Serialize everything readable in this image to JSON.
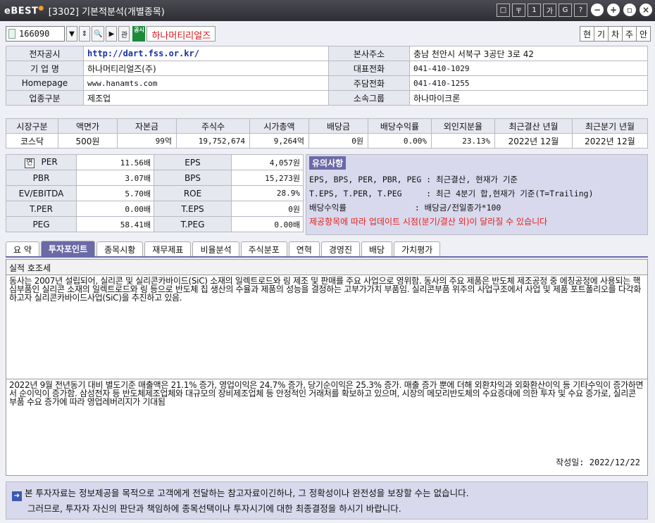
{
  "window": {
    "logo": "eBEST",
    "title": "[3302] 기본적분석(개별종목)",
    "controls": [
      "□",
      "〒",
      "1",
      "가",
      "G",
      "?"
    ]
  },
  "toolbar": {
    "stock_code": "166090",
    "company_name": "하나머티리얼즈",
    "right_buttons": [
      "현",
      "기",
      "차",
      "주",
      "안"
    ],
    "corp_badge": "공시"
  },
  "info": {
    "rows": [
      {
        "l1": "전자공시",
        "v1": "http://dart.fss.or.kr/",
        "l2": "본사주소",
        "v2": "충남 천안시 서북구 3공단 3로 42"
      },
      {
        "l1": "기 업 명",
        "v1": "하나머티리얼즈(주)",
        "l2": "대표전화",
        "v2": "041-410-1029"
      },
      {
        "l1": "Homepage",
        "v1": "www.hanamts.com",
        "l2": "주담전화",
        "v2": "041-410-1255"
      },
      {
        "l1": "업종구분",
        "v1": "제조업",
        "l2": "소속그룹",
        "v2": "하나마이크론"
      }
    ]
  },
  "market": {
    "headers": [
      "시장구분",
      "액면가",
      "자본금",
      "주식수",
      "시가총액",
      "배당금",
      "배당수익률",
      "외인지분율",
      "최근결산 년월",
      "최근분기 년월"
    ],
    "values": [
      "코스닥",
      "500원",
      "99억",
      "19,752,674",
      "9,264억",
      "0원",
      "0.00%",
      "23.13%",
      "2022년 12월",
      "2022년 12월"
    ]
  },
  "ratios": {
    "yun_label": "연",
    "rows": [
      {
        "l1": "PER",
        "v1": "11.56배",
        "l2": "EPS",
        "v2": "4,057원"
      },
      {
        "l1": "PBR",
        "v1": "3.07배",
        "l2": "BPS",
        "v2": "15,273원"
      },
      {
        "l1": "EV/EBITDA",
        "v1": "5.70배",
        "l2": "ROE",
        "v2": "28.9%"
      },
      {
        "l1": "T.PER",
        "v1": "0.00배",
        "l2": "T.EPS",
        "v2": "0원"
      },
      {
        "l1": "PEG",
        "v1": "58.41배",
        "l2": "T.PEG",
        "v2": "0.00배"
      }
    ]
  },
  "notice": {
    "title": "유의사항",
    "lines": [
      "EPS, BPS, PER, PBR, PEG : 최근결산, 현재가 기준",
      "T.EPS, T.PER, T.PEG     : 최근 4분기 합,현재가 기준(T=Trailing)",
      "배당수익률              : 배당금/전일종가*100"
    ],
    "warning": "제공항목에 따라 업데이트 시점(분기/결산 외)이 달라질 수 있습니다"
  },
  "tabs": [
    "요 약",
    "투자포인트",
    "종목시황",
    "재무제표",
    "비율분석",
    "주식분포",
    "연혁",
    "경영진",
    "배당",
    "가치평가"
  ],
  "active_tab": 1,
  "content": {
    "section_title": "실적 호조세",
    "para1": "동사는 2007년 설립되어, 실리콘 및 실리콘카바이드(SiC) 소재의 일렉트로드와 링 제조 및 판매를 주요 사업으로 영위함. 동사의 주요 제품은 반도체 제조공정 중 에칭공정에 사용되는 핵심부품인 실리콘 소재의 일렉트로드와 링 등으로 반도체 칩 생산의 수율과 제품의 성능을 결정하는 고부가가치 부품임. 실리콘부품 위주의 사업구조에서 사업 및 제품 포트폴리오를 다각화하고자 실리콘카바이드사업(SiC)을 추진하고 있음.",
    "para2": "2022년 9월 전년동기 대비 별도기준 매출액은 21.1% 증가, 영업이익은 24.7% 증가, 당기순이익은 25.3% 증가. 매출 증가 뿐에 더해 외환차익과 외화환산이익 등 기타수익이 증가하면서 순이익이 증가함. 삼성전자 등 반도체제조업체와 대규모의 장비제조업체 등 안정적인 거래처를 확보하고 있으며, 시장의 메모리반도체의 수요증대에 의한 투자 및 수요 증가로, 실리콘 부품 수요 증가에 따라 영업레버리지가 기대됨",
    "written": "작성일: 2022/12/22"
  },
  "disclaimer": {
    "line1": "본 투자자료는 정보제공을 목적으로 고객에게 전달하는 참고자료이긴하나, 그 정확성이나 완전성을 보장할 수는 없습니다.",
    "line2": "그러므로, 투자자 자신의 판단과 책임하에 종목선택이나 투자시기에 대한 최종결정을 하시기 바랍니다."
  }
}
